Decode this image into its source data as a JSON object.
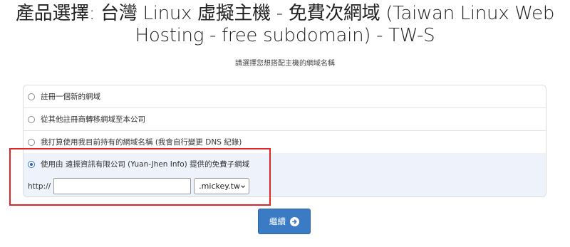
{
  "page": {
    "title_line1": "產品選擇: 台灣 Linux 虛擬主機 - 免費次網域 (Taiwan Linux Web",
    "title_line2": "Hosting - free subdomain) - TW-S",
    "subtitle": "請選擇您想搭配主機的網域名稱"
  },
  "options": [
    {
      "label": "註冊一個新的網域",
      "checked": false
    },
    {
      "label": "從其他註冊商轉移網域至本公司",
      "checked": false
    },
    {
      "label": "我打算使用我目前持有的網域名稱 (我會自行變更 DNS 紀錄)",
      "checked": false
    },
    {
      "label": "使用由 遠振資訊有限公司 (Yuan-Jhen Info) 提供的免費子網域",
      "checked": true
    }
  ],
  "subdomain": {
    "prefix": "http://",
    "value": "",
    "placeholder": "",
    "tld_selected": ".mickey.tw"
  },
  "continue_button": {
    "label": "繼續",
    "icon": "arrow-circle-right-icon"
  },
  "colors": {
    "highlight_border": "#e0252b",
    "button_bg": "#3a7bc4",
    "selected_row_bg": "#eef2fb"
  }
}
